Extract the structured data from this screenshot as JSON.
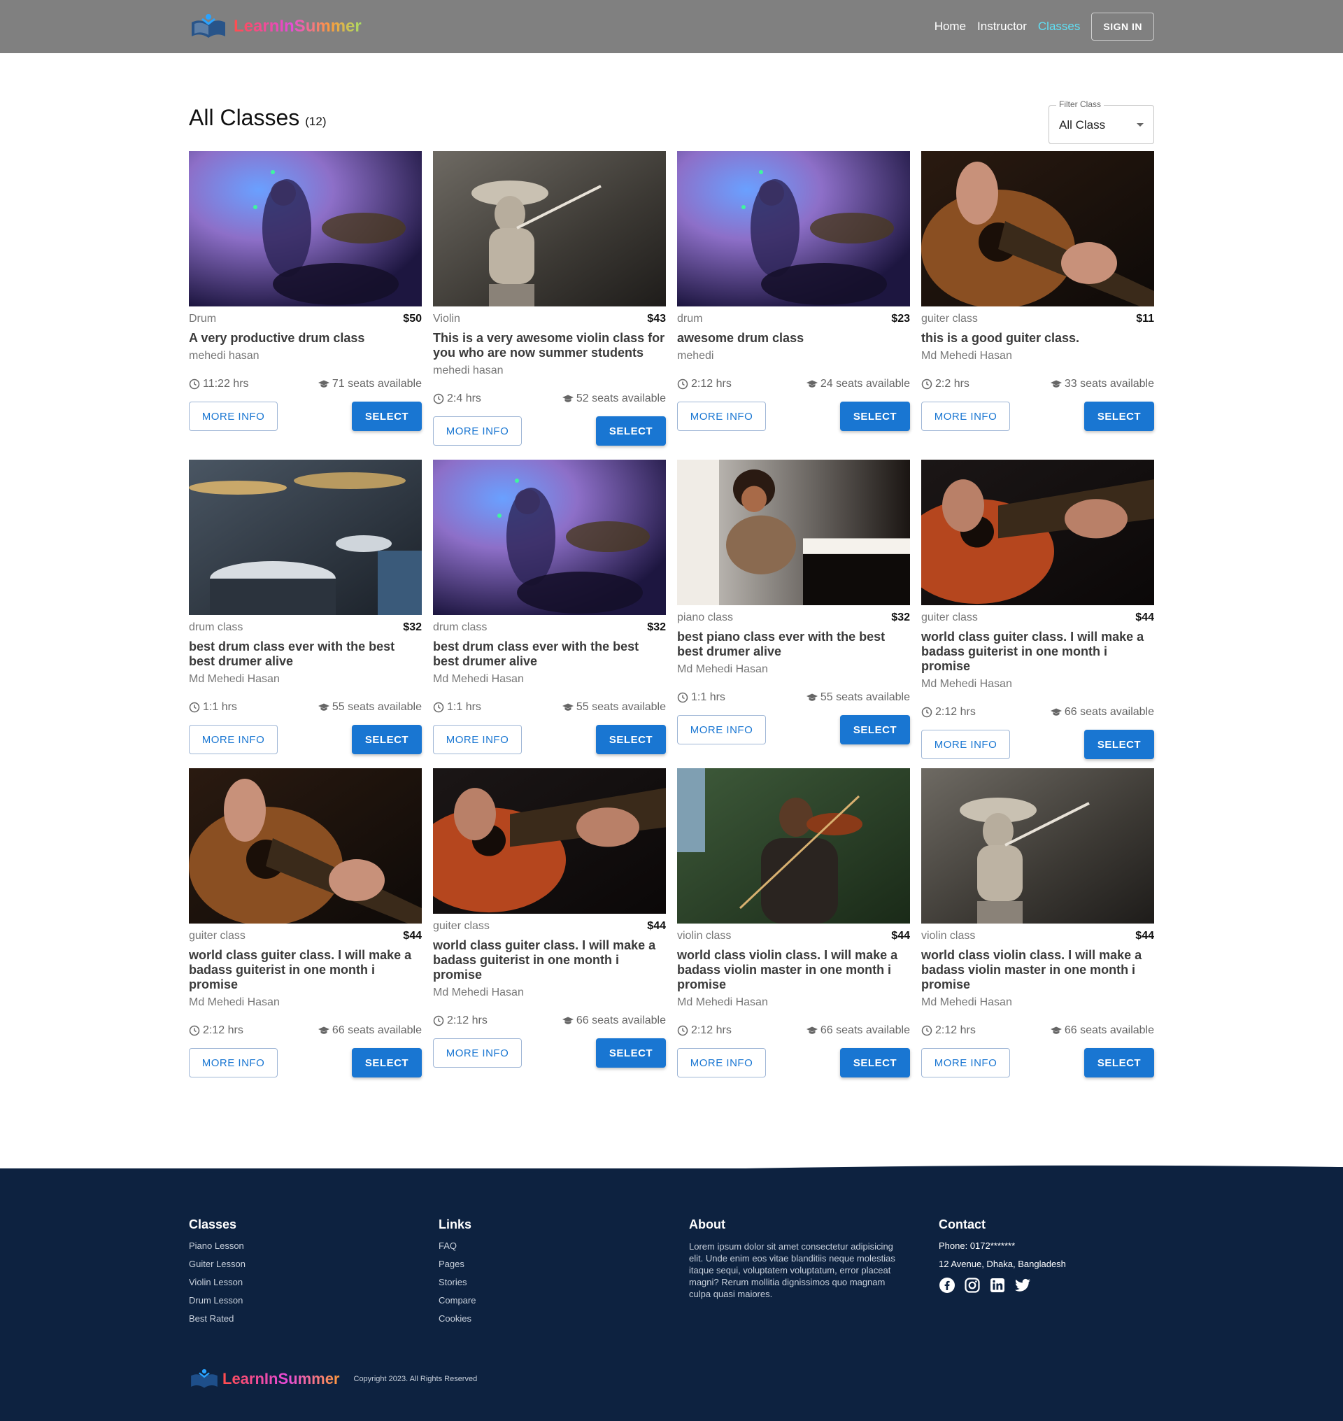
{
  "nav": {
    "brand": "LearnInSummer",
    "links": [
      "Home",
      "Instructor",
      "Classes"
    ],
    "active": "Classes",
    "signin": "SIGN IN"
  },
  "header": {
    "title": "All Classes",
    "count": "(12)"
  },
  "filter": {
    "label": "Filter Class",
    "value": "All Class"
  },
  "buttons": {
    "more": "MORE INFO",
    "select": "SELECT"
  },
  "cards": [
    {
      "category": "Drum",
      "price": "$50",
      "title": "A very productive drum class",
      "instructor": "mehedi hasan",
      "duration": "11:22 hrs",
      "seats": "71 seats available",
      "image": "drum-stage"
    },
    {
      "category": "Violin",
      "price": "$43",
      "title": "This is a very awesome violin class for you who are now summer students",
      "instructor": "mehedi hasan",
      "duration": "2:4 hrs",
      "seats": "52 seats available",
      "image": "violin-boy"
    },
    {
      "category": "drum",
      "price": "$23",
      "title": "awesome drum class",
      "instructor": "mehedi",
      "duration": "2:12 hrs",
      "seats": "24 seats available",
      "image": "drum-stage"
    },
    {
      "category": "guiter class",
      "price": "$11",
      "title": "this is a good guiter class.",
      "instructor": "Md Mehedi Hasan",
      "duration": "2:2 hrs",
      "seats": "33 seats available",
      "image": "guitar-acoustic"
    },
    {
      "category": "drum class",
      "price": "$32",
      "title": "best drum class ever with the best best drumer alive",
      "instructor": "Md Mehedi Hasan",
      "duration": "1:1 hrs",
      "seats": "55 seats available",
      "image": "drum-kit"
    },
    {
      "category": "drum class",
      "price": "$32",
      "title": "best drum class ever with the best best drumer alive",
      "instructor": "Md Mehedi Hasan",
      "duration": "1:1 hrs",
      "seats": "55 seats available",
      "image": "drum-stage"
    },
    {
      "category": "piano class",
      "price": "$32",
      "title": "best piano class ever with the best best drumer alive",
      "instructor": "Md Mehedi Hasan",
      "duration": "1:1 hrs",
      "seats": "55 seats available",
      "image": "piano-child"
    },
    {
      "category": "guiter class",
      "price": "$44",
      "title": "world class guiter class. I will make a badass guiterist in one month i promise",
      "instructor": "Md Mehedi Hasan",
      "duration": "2:12 hrs",
      "seats": "66 seats available",
      "image": "guitar-red"
    },
    {
      "category": "guiter class",
      "price": "$44",
      "title": "world class guiter class. I will make a badass guiterist in one month i promise",
      "instructor": "Md Mehedi Hasan",
      "duration": "2:12 hrs",
      "seats": "66 seats available",
      "image": "guitar-acoustic"
    },
    {
      "category": "guiter class",
      "price": "$44",
      "title": "world class guiter class. I will make a badass guiterist in one month i promise",
      "instructor": "Md Mehedi Hasan",
      "duration": "2:12 hrs",
      "seats": "66 seats available",
      "image": "guitar-red"
    },
    {
      "category": "violin class",
      "price": "$44",
      "title": "world class violin class. I will make a badass violin master in one month i promise",
      "instructor": "Md Mehedi Hasan",
      "duration": "2:12 hrs",
      "seats": "66 seats available",
      "image": "violin-man"
    },
    {
      "category": "violin class",
      "price": "$44",
      "title": "world class violin class. I will make a badass violin master in one month i promise",
      "instructor": "Md Mehedi Hasan",
      "duration": "2:12 hrs",
      "seats": "66 seats available",
      "image": "violin-boy"
    }
  ],
  "footer": {
    "classes": {
      "heading": "Classes",
      "items": [
        "Piano Lesson",
        "Guiter Lesson",
        "Violin Lesson",
        "Drum Lesson",
        "Best Rated"
      ]
    },
    "links": {
      "heading": "Links",
      "items": [
        "FAQ",
        "Pages",
        "Stories",
        "Compare",
        "Cookies"
      ]
    },
    "about": {
      "heading": "About",
      "text": "Lorem ipsum dolor sit amet consectetur adipisicing elit. Unde enim eos vitae blanditiis neque molestias itaque sequi, voluptatem voluptatum, error placeat magni? Rerum mollitia dignissimos quo magnam culpa quasi maiores."
    },
    "contact": {
      "heading": "Contact",
      "phone": "Phone: 0172*******",
      "address": "12 Avenue, Dhaka, Bangladesh",
      "socials": [
        "facebook-icon",
        "instagram-icon",
        "linkedin-icon",
        "twitter-icon"
      ]
    },
    "brand": "LearnInSummer",
    "copyright": "Copyright 2023. All Rights Reserved"
  },
  "colors": {
    "navbar": "#808080",
    "accent": "#1976d2",
    "active_link": "#5fe0f5",
    "footer": "#0d2240"
  }
}
